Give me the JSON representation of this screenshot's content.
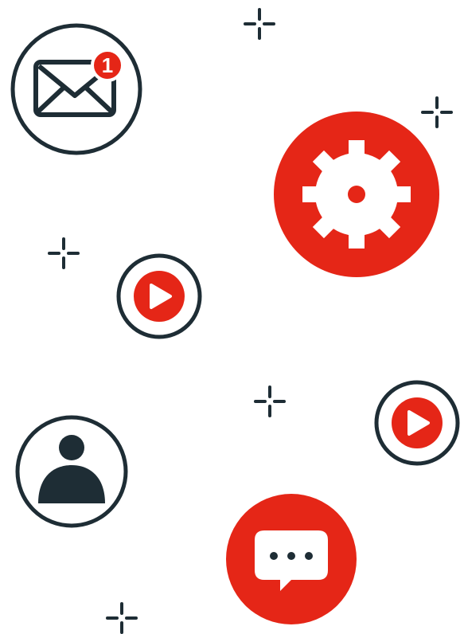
{
  "colors": {
    "dark": "#1e2d35",
    "red": "#e52617",
    "white": "#ffffff"
  },
  "mail": {
    "icon": "envelope-icon",
    "badge_count": "1"
  },
  "icons": {
    "gear": "gear-icon",
    "play_small_left": "play-icon",
    "play_small_right": "play-icon",
    "user": "user-icon",
    "chat": "chat-bubble-icon",
    "sparkle": "sparkle-icon"
  }
}
